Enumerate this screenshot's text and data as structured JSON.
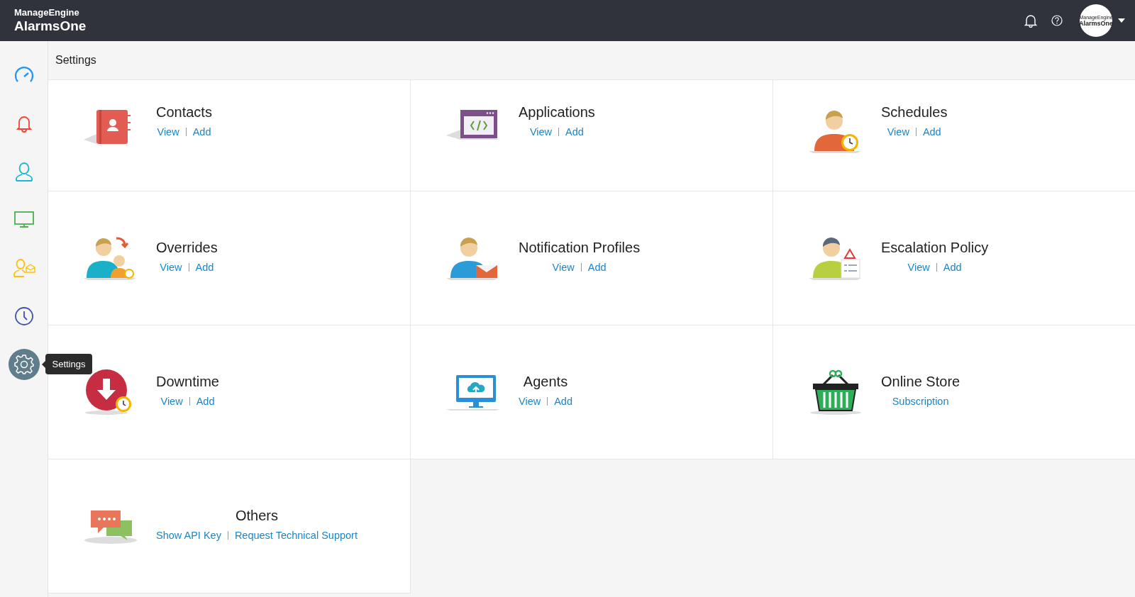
{
  "header": {
    "brand_top": "ManageEngine",
    "brand_name": "AlarmsOne",
    "avatar": {
      "line_1": "ManageEngine",
      "line_2": "AlarmsOne"
    }
  },
  "sidebar": {
    "items": [
      {
        "kind": "dashboard",
        "selected": false
      },
      {
        "kind": "alarms",
        "selected": false
      },
      {
        "kind": "users",
        "selected": false
      },
      {
        "kind": "monitor",
        "selected": false
      },
      {
        "kind": "contacts",
        "selected": false
      },
      {
        "kind": "history",
        "selected": false
      },
      {
        "kind": "settings",
        "selected": true,
        "tooltip": "Settings"
      }
    ]
  },
  "page_title": "Settings",
  "tiles": [
    {
      "kind": "contacts",
      "title": "Contacts",
      "links": [
        "View",
        "Add"
      ]
    },
    {
      "kind": "applications",
      "title": "Applications",
      "links": [
        "View",
        "Add"
      ]
    },
    {
      "kind": "schedules",
      "title": "Schedules",
      "links": [
        "View",
        "Add"
      ]
    },
    {
      "kind": "overrides",
      "title": "Overrides",
      "links": [
        "View",
        "Add"
      ]
    },
    {
      "kind": "notification",
      "title": "Notification Profiles",
      "links": [
        "View",
        "Add"
      ]
    },
    {
      "kind": "escalation",
      "title": "Escalation Policy",
      "links": [
        "View",
        "Add"
      ]
    },
    {
      "kind": "downtime",
      "title": "Downtime",
      "links": [
        "View",
        "Add"
      ]
    },
    {
      "kind": "agents",
      "title": "Agents",
      "links": [
        "View",
        "Add"
      ]
    },
    {
      "kind": "store",
      "title": "Online Store",
      "links": [
        "Subscription"
      ]
    },
    {
      "kind": "others",
      "title": "Others",
      "links": [
        "Show API Key",
        "Request Technical Support"
      ]
    }
  ]
}
